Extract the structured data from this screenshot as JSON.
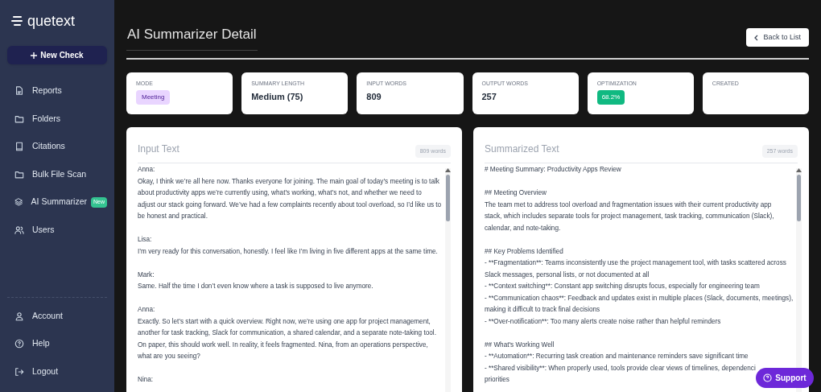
{
  "logo": "quetext",
  "new_check": "New Check",
  "nav": [
    {
      "label": "Reports",
      "selected": false
    },
    {
      "label": "Folders",
      "selected": false
    },
    {
      "label": "Citations",
      "selected": false
    },
    {
      "label": "Bulk File Scan",
      "selected": false
    },
    {
      "label": "AI Summarizer",
      "badge": "New",
      "selected": false
    },
    {
      "label": "Users",
      "selected": false
    }
  ],
  "nav_bottom": [
    {
      "label": "Account"
    },
    {
      "label": "Help"
    },
    {
      "label": "Logout"
    }
  ],
  "page_title": "AI Summarizer Detail",
  "back_button": "Back to List",
  "stats": [
    {
      "label": "MODE",
      "kind": "tag",
      "value": "Meeting"
    },
    {
      "label": "SUMMARY LENGTH",
      "kind": "text",
      "value": "Medium (75)"
    },
    {
      "label": "INPUT WORDS",
      "kind": "text",
      "value": "809"
    },
    {
      "label": "OUTPUT WORDS",
      "kind": "text",
      "value": "257"
    },
    {
      "label": "OPTIMIZATION",
      "kind": "pill",
      "value": "68.2%"
    },
    {
      "label": "CREATED",
      "kind": "empty"
    }
  ],
  "panels": [
    {
      "title": "Input Text",
      "count": "809 words",
      "paragraphs": [
        [
          "Anna:",
          "Okay, I think we’re all here now. Thanks everyone for joining. The main goal of today’s meeting is to talk",
          "about productivity apps we’re currently using, what’s working, what’s not, and whether we need to",
          "adjust our stack going forward. We’ve had a few complaints recently about tool overload, so I’d like us to",
          "be honest and practical."
        ],
        [
          "Lisa:",
          "I’m very ready for this conversation, honestly. I feel like I’m living in five different apps at the same time."
        ],
        [
          "Mark:",
          "Same. Half the time I don’t even know where a task is supposed to live anymore."
        ],
        [
          "Anna:",
          "Exactly. So let’s start with a quick overview. Right now, we’re using one app for project management,",
          "another for task tracking, Slack for communication, a shared calendar, and a separate note-taking tool.",
          "On paper, this should work well. In reality, it feels fragmented. Nina, from an operations perspective,",
          "what are you seeing?"
        ],
        [
          "Nina:"
        ]
      ]
    },
    {
      "title": "Summarized Text",
      "count": "257 words",
      "paragraphs": [
        [
          "# Meeting Summary: Productivity Apps Review"
        ],
        [
          "## Meeting Overview",
          "The team met to address tool overload and fragmentation issues with their current productivity app",
          "stack, which includes separate tools for project management, task tracking, communication (Slack),",
          "calendar, and note-taking."
        ],
        [
          "## Key Problems Identified",
          "- **Fragmentation**: Teams inconsistently use the project management tool, with tasks scattered across",
          "Slack messages, personal lists, or not documented at all",
          "- **Context switching**: Constant app switching disrupts focus, especially for engineering team",
          "- **Communication chaos**: Feedback and updates exist in multiple places (Slack, documents, meetings),",
          "making it difficult to track final decisions",
          "- **Over-notification**: Too many alerts create noise rather than helpful reminders"
        ],
        [
          "## What's Working Well",
          "- **Automation**: Recurring task creation and maintenance reminders save significant time",
          "- **Shared visibility**: When properly used, tools provide clear views of timelines, dependenci",
          "priorities"
        ]
      ]
    }
  ],
  "support_button": "Support"
}
